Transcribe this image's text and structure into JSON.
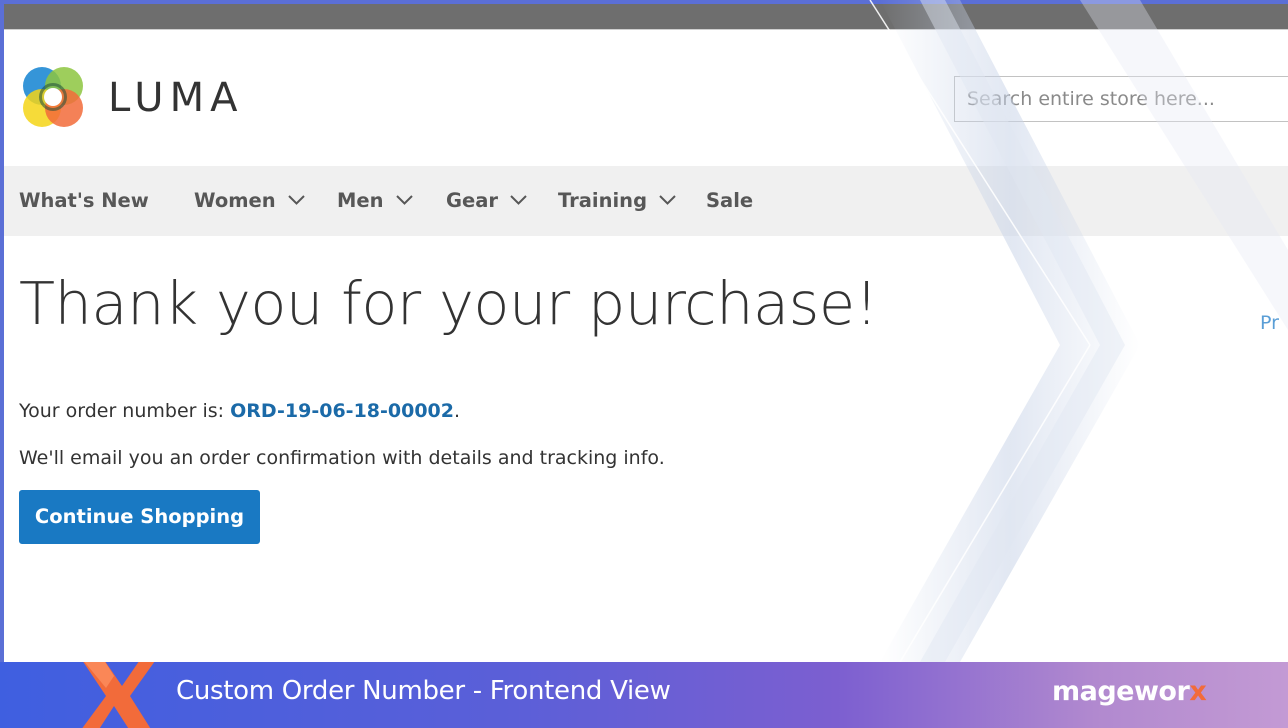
{
  "logo": {
    "text": "LUMA"
  },
  "search": {
    "placeholder": "Search entire store here..."
  },
  "nav": {
    "items": [
      {
        "label": "What's New",
        "has_dropdown": false
      },
      {
        "label": "Women",
        "has_dropdown": true
      },
      {
        "label": "Men",
        "has_dropdown": true
      },
      {
        "label": "Gear",
        "has_dropdown": true
      },
      {
        "label": "Training",
        "has_dropdown": true
      },
      {
        "label": "Sale",
        "has_dropdown": false
      }
    ]
  },
  "main": {
    "title": "Thank you for your purchase!",
    "order_prefix": "Your order number is: ",
    "order_number": "ORD-19-06-18-00002",
    "order_suffix": ".",
    "email_text": "We'll email you an order confirmation with details and tracking info.",
    "continue_label": "Continue Shopping",
    "side_link": "Pr"
  },
  "banner": {
    "title": "Custom Order Number - Frontend View",
    "brand": "magewor",
    "brand_x": "x"
  },
  "colors": {
    "button": "#1979c3",
    "order_link": "#1b6aa8",
    "nav_bg": "#f0f0f0",
    "banner_start": "#3f5fe0",
    "banner_end": "#c39ad4",
    "accent_orange": "#f26b3a"
  }
}
